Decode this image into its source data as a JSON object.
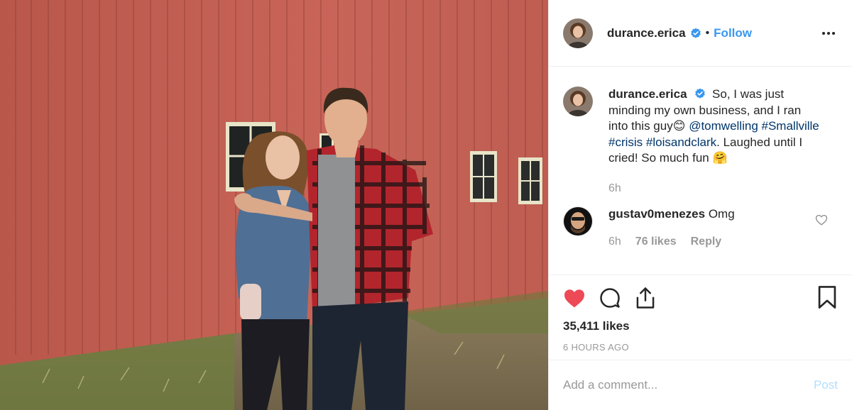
{
  "post": {
    "author": "durance.erica",
    "follow_label": "Follow",
    "separator": "•",
    "caption": {
      "text_before": "So, I was just minding my own business, and I ran into this guy",
      "emoji_1": "😊",
      "mention": "@tomwelling",
      "hashtag_1": "#Smallville",
      "hashtag_2": "#crisis",
      "hashtag_3": "#loisandclark",
      "text_after": ". Laughed until I cried! So much fun",
      "emoji_2": "🤗",
      "time": "6h"
    },
    "comments": [
      {
        "user": "gustav0menezes",
        "text": "Omg",
        "time": "6h",
        "likes": "76 likes",
        "reply": "Reply"
      }
    ],
    "likes_count": "35,411 likes",
    "posted_ago": "6 HOURS AGO",
    "add_comment_placeholder": "Add a comment...",
    "post_label": "Post"
  },
  "colors": {
    "accent": "#3897f0",
    "like_red": "#ed4956",
    "hashtag": "#003569",
    "muted": "#999999",
    "post_disabled": "#b2dffc"
  },
  "icons": {
    "verified": "verified-badge-icon",
    "more": "more-options-icon",
    "heart": "heart-icon",
    "comment": "comment-icon",
    "share": "share-icon",
    "bookmark": "bookmark-icon"
  }
}
